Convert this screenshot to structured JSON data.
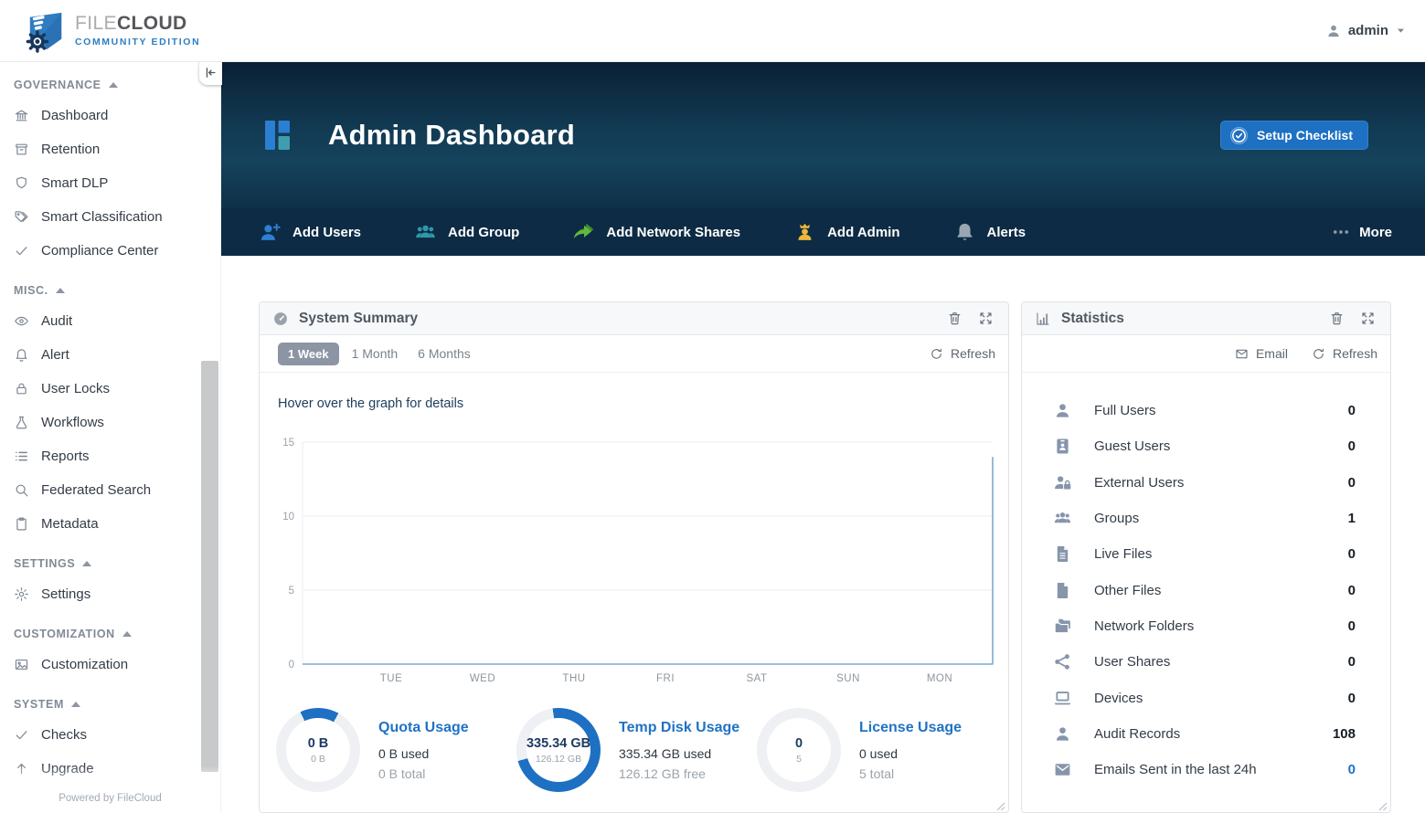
{
  "brand": {
    "logo_text_1": "FILE",
    "logo_text_2": "CLOUD",
    "edition": "COMMUNITY EDITION"
  },
  "topbar": {
    "username": "admin"
  },
  "sidebar": {
    "sections": [
      {
        "label": "GOVERNANCE",
        "items": [
          {
            "icon": "bank-icon",
            "label": "Dashboard"
          },
          {
            "icon": "archive-icon",
            "label": "Retention"
          },
          {
            "icon": "shield-icon",
            "label": "Smart DLP"
          },
          {
            "icon": "tags-icon",
            "label": "Smart Classification"
          },
          {
            "icon": "check-icon",
            "label": "Compliance Center"
          }
        ]
      },
      {
        "label": "MISC.",
        "items": [
          {
            "icon": "eye-icon",
            "label": "Audit"
          },
          {
            "icon": "bell-icon",
            "label": "Alert"
          },
          {
            "icon": "lock-icon",
            "label": "User Locks"
          },
          {
            "icon": "flask-icon",
            "label": "Workflows"
          },
          {
            "icon": "list-icon",
            "label": "Reports"
          },
          {
            "icon": "search-icon",
            "label": "Federated Search"
          },
          {
            "icon": "clipboard-icon",
            "label": "Metadata"
          }
        ]
      },
      {
        "label": "SETTINGS",
        "items": [
          {
            "icon": "gear-icon",
            "label": "Settings"
          }
        ]
      },
      {
        "label": "CUSTOMIZATION",
        "items": [
          {
            "icon": "image-icon",
            "label": "Customization"
          }
        ]
      },
      {
        "label": "SYSTEM",
        "items": [
          {
            "icon": "check-icon",
            "label": "Checks"
          },
          {
            "icon": "arrow-up-icon",
            "label": "Upgrade"
          }
        ]
      }
    ],
    "footer": "Powered by FileCloud"
  },
  "hero": {
    "title": "Admin Dashboard",
    "setup_button": "Setup Checklist"
  },
  "quick_actions": {
    "items": [
      {
        "icon": "add-user-icon",
        "label": "Add Users",
        "color": "#2d7fd3"
      },
      {
        "icon": "group-icon",
        "label": "Add Group",
        "color": "#2f97a8"
      },
      {
        "icon": "share-arrows-icon",
        "label": "Add Network Shares",
        "color": "#62b83f"
      },
      {
        "icon": "admin-user-icon",
        "label": "Add Admin",
        "color": "#ecb73b"
      },
      {
        "icon": "bell-fill-icon",
        "label": "Alerts",
        "color": "#9aa6b2"
      }
    ],
    "more_label": "More"
  },
  "system_summary": {
    "title": "System Summary",
    "tabs": [
      {
        "label": "1 Week",
        "active": true
      },
      {
        "label": "1 Month",
        "active": false
      },
      {
        "label": "6 Months",
        "active": false
      }
    ],
    "refresh_label": "Refresh",
    "hint": "Hover over the graph for details",
    "gauges": [
      {
        "title": "Quota Usage",
        "center": "0 B",
        "center_sub": "0 B",
        "used": "0 B used",
        "total": "0 B total",
        "percent": 15,
        "start_deg": -25
      },
      {
        "title": "Temp Disk Usage",
        "center": "335.34 GB",
        "center_sub": "126.12 GB",
        "used": "335.34 GB used",
        "total": "126.12 GB free",
        "percent": 73,
        "start_deg": -8
      },
      {
        "title": "License Usage",
        "center": "0",
        "center_sub": "5",
        "used": "0 used",
        "total": "5 total",
        "percent": 0,
        "start_deg": 0
      }
    ]
  },
  "chart_data": {
    "type": "line",
    "title": "",
    "x": [
      "TUE",
      "WED",
      "THU",
      "FRI",
      "SAT",
      "SUN",
      "MON"
    ],
    "values": [
      0,
      0,
      0,
      0,
      0,
      0,
      0
    ],
    "trailing_edge_value": 14,
    "ylim": [
      0,
      15
    ],
    "yticks": [
      0,
      5,
      10,
      15
    ],
    "grid": "horizontal",
    "legend": "none",
    "line_color": "#7aa9d8"
  },
  "statistics": {
    "title": "Statistics",
    "email_label": "Email",
    "refresh_label": "Refresh",
    "rows": [
      {
        "icon": "user-icon",
        "label": "Full Users",
        "value": "0"
      },
      {
        "icon": "id-badge-icon",
        "label": "Guest Users",
        "value": "0"
      },
      {
        "icon": "user-lock-icon",
        "label": "External Users",
        "value": "0"
      },
      {
        "icon": "users-icon",
        "label": "Groups",
        "value": "1"
      },
      {
        "icon": "file-lines-icon",
        "label": "Live Files",
        "value": "0"
      },
      {
        "icon": "file-icon",
        "label": "Other Files",
        "value": "0"
      },
      {
        "icon": "folders-icon",
        "label": "Network Folders",
        "value": "0"
      },
      {
        "icon": "share-icon",
        "label": "User Shares",
        "value": "0"
      },
      {
        "icon": "laptop-icon",
        "label": "Devices",
        "value": "0"
      },
      {
        "icon": "user-icon",
        "label": "Audit Records",
        "value": "108"
      },
      {
        "icon": "envelope-icon",
        "label": "Emails Sent in the last 24h",
        "value": "0",
        "highlight": true
      }
    ]
  },
  "colors": {
    "accent": "#1d70c2",
    "donut_fill": "#1d70c2",
    "donut_track": "#eef0f3",
    "value_highlight": "#1a73c8"
  }
}
